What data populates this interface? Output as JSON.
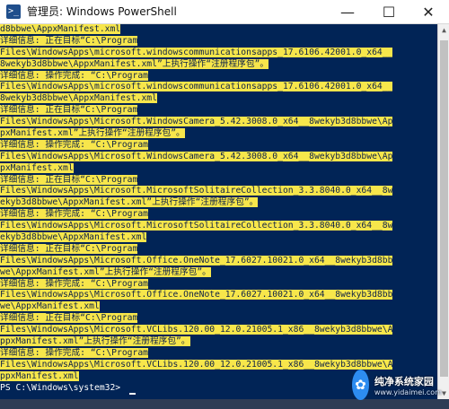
{
  "window": {
    "title": "管理员: Windows PowerShell",
    "icon": "powershell-icon",
    "controls": {
      "minimize": "—",
      "maximize": "☐",
      "close": "✕"
    }
  },
  "console": {
    "lines": [
      "d8bbwe\\AppxManifest.xml",
      "详细信息: 正在目标“C:\\Program",
      "Files\\WindowsApps\\microsoft.windowscommunicationsapps_17.6106.42001.0_x64__",
      "8wekyb3d8bbwe\\AppxManifest.xml”上执行操作“注册程序包”。",
      "详细信息: 操作完成: “C:\\Program",
      "Files\\WindowsApps\\microsoft.windowscommunicationsapps_17.6106.42001.0_x64__",
      "8wekyb3d8bbwe\\AppxManifest.xml",
      "详细信息: 正在目标“C:\\Program",
      "Files\\WindowsApps\\Microsoft.WindowsCamera_5.42.3008.0_x64__8wekyb3d8bbwe\\Ap",
      "pxManifest.xml”上执行操作“注册程序包”。",
      "详细信息: 操作完成: “C:\\Program",
      "Files\\WindowsApps\\Microsoft.WindowsCamera_5.42.3008.0_x64__8wekyb3d8bbwe\\Ap",
      "pxManifest.xml",
      "详细信息: 正在目标“C:\\Program",
      "Files\\WindowsApps\\Microsoft.MicrosoftSolitaireCollection_3.3.8040.0_x64__8w",
      "ekyb3d8bbwe\\AppxManifest.xml”上执行操作“注册程序包”。",
      "详细信息: 操作完成: “C:\\Program",
      "Files\\WindowsApps\\Microsoft.MicrosoftSolitaireCollection_3.3.8040.0_x64__8w",
      "ekyb3d8bbwe\\AppxManifest.xml",
      "详细信息: 正在目标“C:\\Program",
      "Files\\WindowsApps\\Microsoft.Office.OneNote_17.6027.10021.0_x64__8wekyb3d8bb",
      "we\\AppxManifest.xml”上执行操作“注册程序包”。",
      "详细信息: 操作完成: “C:\\Program",
      "Files\\WindowsApps\\Microsoft.Office.OneNote_17.6027.10021.0_x64__8wekyb3d8bb",
      "we\\AppxManifest.xml",
      "详细信息: 正在目标“C:\\Program",
      "Files\\WindowsApps\\Microsoft.VCLibs.120.00_12.0.21005.1_x86__8wekyb3d8bbwe\\A",
      "ppxManifest.xml”上执行操作“注册程序包”。",
      "详细信息: 操作完成: “C:\\Program",
      "Files\\WindowsApps\\Microsoft.VCLibs.120.00_12.0.21005.1_x86__8wekyb3d8bbwe\\A",
      "ppxManifest.xml"
    ],
    "prompt": "PS C:\\Windows\\system32> ",
    "colors": {
      "background": "#012456",
      "selection": "#f7e64b",
      "selection_text": "#0f2347",
      "prompt_text": "#ffffff"
    }
  },
  "scrollbar": {
    "up_icon": "▲",
    "down_icon": "▼"
  },
  "watermark": {
    "logo_icon": "paw-icon",
    "logo_glyph": "✿",
    "text_cn": "纯净系统家园",
    "text_en": "www.yidaimei.com"
  }
}
